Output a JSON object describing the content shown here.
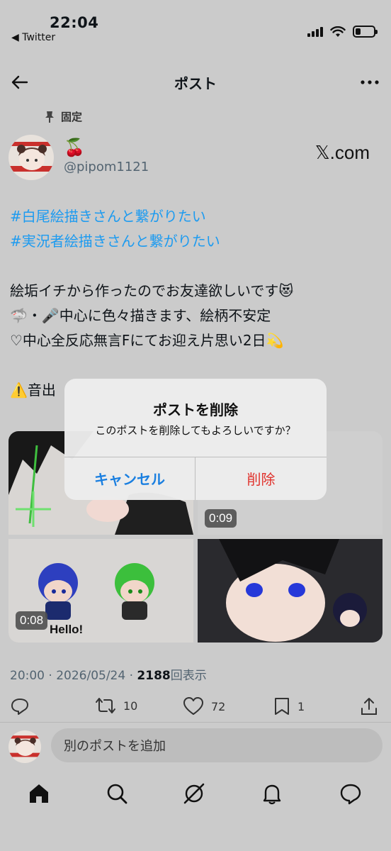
{
  "status_bar": {
    "time": "22:04",
    "back_app": "◀ Twitter",
    "battery_level": 0.3
  },
  "header": {
    "title": "ポスト"
  },
  "post": {
    "pinned_label": "固定",
    "display_name": "🍒",
    "handle": "@pipom1121",
    "brand": "𝕏.com",
    "lines": [
      "#白尾絵描きさんと繋がりたい",
      " #実況者絵描きさんと繋がりたい",
      "絵垢イチから作ったのでお友達欲しいです😻",
      "🦈・🎤中心に色々描きます、絵柄不安定",
      "♡中心全反応無言Fにてお迎え片思い2日💫",
      "⚠️音出"
    ],
    "media": [
      {
        "duration": ""
      },
      {
        "duration": "0:09"
      },
      {
        "duration": "0:08",
        "caption": "Hello!"
      },
      {
        "duration": ""
      }
    ],
    "meta_time": "20:00 · 2026/05/24 · ",
    "views_count": "2188",
    "views_label": "回表示",
    "retweets": "10",
    "likes": "72",
    "bookmarks": "1"
  },
  "reply": {
    "placeholder": "別のポストを追加"
  },
  "dialog": {
    "title": "ポストを削除",
    "message": "このポストを削除してもよろしいですか？",
    "cancel": "キャンセル",
    "delete": "削除"
  },
  "colors": {
    "accent": "#1d9bf0",
    "destructive": "#e0312b",
    "dialog_action": "#1a7fe0"
  }
}
